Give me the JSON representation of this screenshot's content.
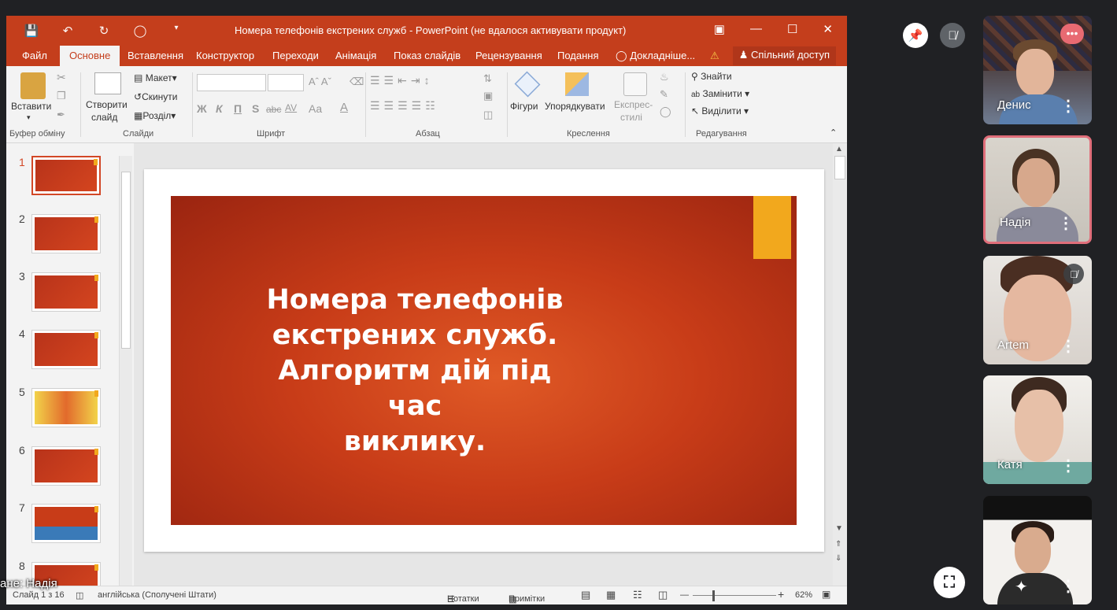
{
  "window": {
    "title": "Номера телефонів екстрених служб - PowerPoint (не вдалося активувати продукт)"
  },
  "tabs": [
    "Файл",
    "Основне",
    "Вставлення",
    "Конструктор",
    "Переходи",
    "Анімація",
    "Показ слайдів",
    "Рецензування",
    "Подання",
    "Докладніше..."
  ],
  "share_label": "Спільний доступ",
  "ribbon": {
    "clipboard": {
      "paste": "Вставити",
      "label": "Буфер обміну"
    },
    "slides": {
      "new_slide_1": "Створити",
      "new_slide_2": "слайд",
      "layout": "Макет",
      "reset": "Скинути",
      "section": "Розділ",
      "label": "Слайди"
    },
    "font": {
      "label": "Шрифт",
      "bold": "Ж",
      "italic": "К",
      "underline": "П",
      "shadow": "S",
      "strike": "abc",
      "spacing": "AV",
      "case": "Aa",
      "color": "A"
    },
    "paragraph": {
      "label": "Абзац"
    },
    "drawing": {
      "shapes": "Фігури",
      "arrange": "Упорядкувати",
      "quick_styles_1": "Експрес-",
      "quick_styles_2": "стилі",
      "label": "Креслення"
    },
    "editing": {
      "find": "Знайти",
      "replace": "Замінити",
      "select": "Виділити",
      "label": "Редагування"
    }
  },
  "thumbnails": [
    "1",
    "2",
    "3",
    "4",
    "5",
    "6",
    "7",
    "8"
  ],
  "slide": {
    "headline_lines": [
      "Номера телефонів",
      "екстрених служб.",
      "Алгоритм дій під час",
      "виклику."
    ]
  },
  "status": {
    "slide_count": "Слайд 1 з 16",
    "language": "англійська (Сполучені Штати)",
    "notes": "Нотатки",
    "comments": "Примітки",
    "zoom": "62%"
  },
  "presenter_overlay": "ане: Надія",
  "participants": [
    {
      "name": "Денис",
      "muted": false,
      "speaking": true
    },
    {
      "name": "Надія",
      "muted": false,
      "speaking": false,
      "highlighted": true
    },
    {
      "name": "Artem",
      "muted": true,
      "speaking": false
    },
    {
      "name": "Катя",
      "muted": false,
      "speaking": false
    },
    {
      "name": "",
      "muted": false,
      "speaking": false
    }
  ],
  "colors": {
    "ppt_accent": "#c43e1c",
    "slide_red": "#c83c18",
    "slide_flag": "#f2a81d",
    "meet_bg": "#202124",
    "highlight_border": "#e06e7a"
  },
  "icons": [
    "save-icon",
    "undo-icon",
    "redo-icon",
    "present-icon",
    "restore-ribbon-icon",
    "minimize-icon",
    "maximize-icon",
    "close-icon",
    "lightbulb-icon",
    "warning-icon",
    "person-icon",
    "pin-icon",
    "mic-off-icon",
    "more-icon",
    "fullscreen-icon",
    "sparkle-icon"
  ]
}
